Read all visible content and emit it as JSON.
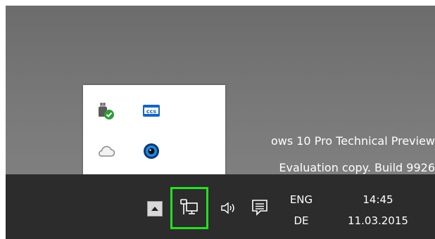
{
  "desktop": {
    "watermark_line1": "ows 10 Pro Technical Preview",
    "watermark_line2": "Evaluation copy. Build 9926"
  },
  "tray_overflow": {
    "icons": [
      {
        "name": "usb-safely-remove-icon"
      },
      {
        "name": "ccs-app-icon"
      },
      {
        "name": "cloud-icon"
      },
      {
        "name": "webcam-icon"
      }
    ]
  },
  "taskbar": {
    "show_hidden_icons": "chevron-up-icon",
    "network_icon": "network-icon",
    "volume_icon": "speaker-icon",
    "action_center_icon": "notification-icon",
    "language": {
      "code": "ENG",
      "layout": "DE"
    },
    "clock": {
      "time": "14:45",
      "date": "11.03.2015"
    }
  },
  "colors": {
    "highlight": "#22e022",
    "taskbar": "#2c2c2c",
    "desktop": "#7a7a7a"
  }
}
